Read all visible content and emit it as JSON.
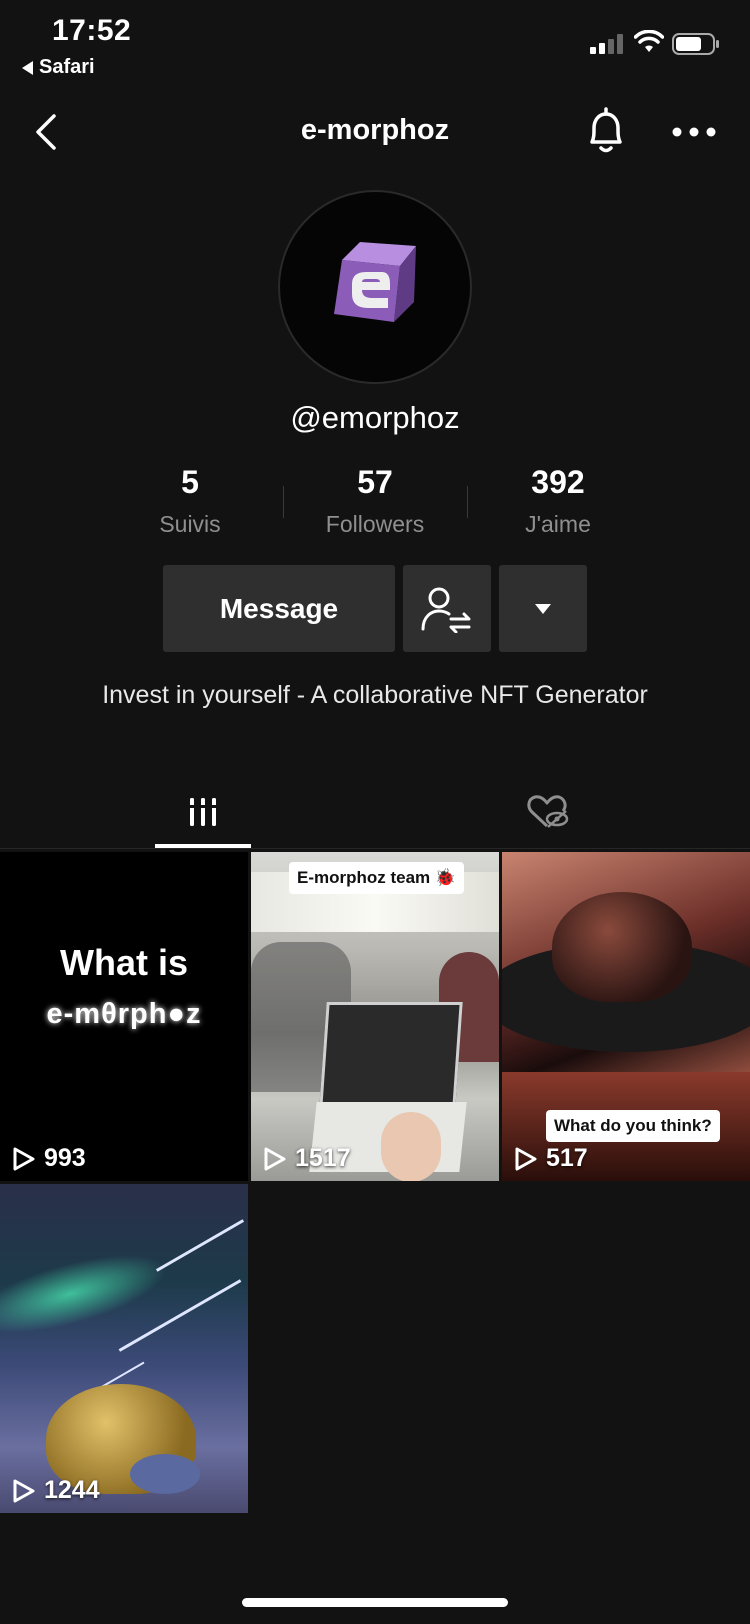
{
  "status_bar": {
    "time": "17:52",
    "back_app": "Safari"
  },
  "nav": {
    "title": "e-morphoz"
  },
  "profile": {
    "handle": "@emorphoz",
    "bio": "Invest in yourself - A collaborative NFT Generator"
  },
  "stats": [
    {
      "value": "5",
      "label": "Suivis"
    },
    {
      "value": "57",
      "label": "Followers"
    },
    {
      "value": "392",
      "label": "J'aime"
    }
  ],
  "actions": {
    "message_label": "Message"
  },
  "tabs": {
    "active": "videos"
  },
  "videos": [
    {
      "views": "993",
      "overlay_title": "What is",
      "overlay_sub": "e-mθrph●z"
    },
    {
      "views": "1517",
      "caption": "E-morphoz team 🐞"
    },
    {
      "views": "517",
      "caption": "What do you think?"
    },
    {
      "views": "1244"
    }
  ],
  "colors": {
    "background": "#121212",
    "button": "#2f2f2f",
    "secondary_text": "#8f8f8f",
    "logo": "#8b5cb8"
  }
}
